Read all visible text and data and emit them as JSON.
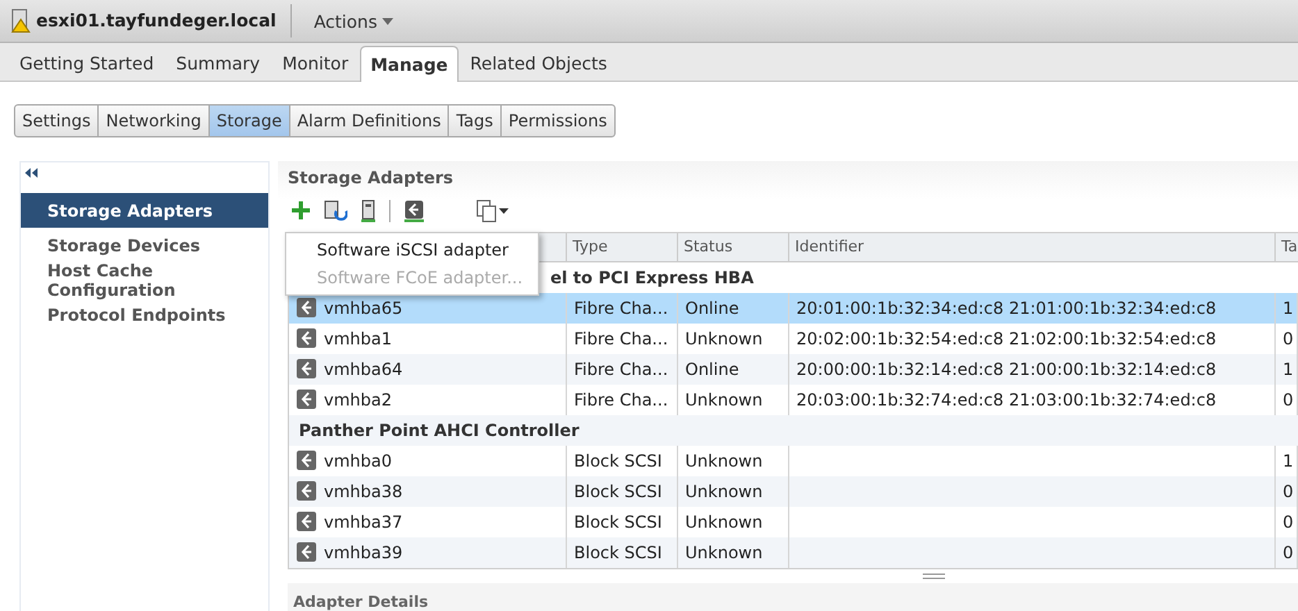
{
  "header": {
    "title": "esxi01.tayfundeger.local",
    "actions": "Actions"
  },
  "tabs": [
    {
      "label": "Getting Started",
      "selected": false
    },
    {
      "label": "Summary",
      "selected": false
    },
    {
      "label": "Monitor",
      "selected": false
    },
    {
      "label": "Manage",
      "selected": true
    },
    {
      "label": "Related Objects",
      "selected": false
    }
  ],
  "subtabs": [
    {
      "label": "Settings",
      "selected": false
    },
    {
      "label": "Networking",
      "selected": false
    },
    {
      "label": "Storage",
      "selected": true
    },
    {
      "label": "Alarm Definitions",
      "selected": false
    },
    {
      "label": "Tags",
      "selected": false
    },
    {
      "label": "Permissions",
      "selected": false
    }
  ],
  "sidebar": {
    "items": [
      {
        "label": "Storage Adapters",
        "selected": true
      },
      {
        "label": "Storage Devices",
        "selected": false
      },
      {
        "label": "Host Cache Configuration",
        "selected": false
      },
      {
        "label": "Protocol Endpoints",
        "selected": false
      }
    ]
  },
  "panel": {
    "title": "Storage Adapters",
    "details_title": "Adapter Details"
  },
  "add_menu": [
    {
      "label": "Software iSCSI adapter",
      "disabled": false
    },
    {
      "label": "Software FCoE adapter...",
      "disabled": true
    }
  ],
  "table": {
    "columns": [
      "Type",
      "Status",
      "Identifier",
      "Ta"
    ],
    "rows": [
      {
        "kind": "group",
        "label": "el to PCI Express HBA"
      },
      {
        "kind": "adapter",
        "selected": true,
        "cells": [
          "vmhba65",
          "Fibre Cha...",
          "Online",
          "20:01:00:1b:32:34:ed:c8 21:01:00:1b:32:34:ed:c8",
          "1"
        ]
      },
      {
        "kind": "adapter",
        "selected": false,
        "cells": [
          "vmhba1",
          "Fibre Cha...",
          "Unknown",
          "20:02:00:1b:32:54:ed:c8 21:02:00:1b:32:54:ed:c8",
          "0"
        ]
      },
      {
        "kind": "adapter",
        "selected": false,
        "cells": [
          "vmhba64",
          "Fibre Cha...",
          "Online",
          "20:00:00:1b:32:14:ed:c8 21:00:00:1b:32:14:ed:c8",
          "1"
        ]
      },
      {
        "kind": "adapter",
        "selected": false,
        "cells": [
          "vmhba2",
          "Fibre Cha...",
          "Unknown",
          "20:03:00:1b:32:74:ed:c8 21:03:00:1b:32:74:ed:c8",
          "0"
        ]
      },
      {
        "kind": "group",
        "label": "Panther Point AHCI Controller"
      },
      {
        "kind": "adapter",
        "selected": false,
        "cells": [
          "vmhba0",
          "Block SCSI",
          "Unknown",
          "",
          "1"
        ]
      },
      {
        "kind": "adapter",
        "selected": false,
        "cells": [
          "vmhba38",
          "Block SCSI",
          "Unknown",
          "",
          "0"
        ]
      },
      {
        "kind": "adapter",
        "selected": false,
        "cells": [
          "vmhba37",
          "Block SCSI",
          "Unknown",
          "",
          "0"
        ]
      },
      {
        "kind": "adapter",
        "selected": false,
        "cells": [
          "vmhba39",
          "Block SCSI",
          "Unknown",
          "",
          "0"
        ]
      }
    ]
  }
}
